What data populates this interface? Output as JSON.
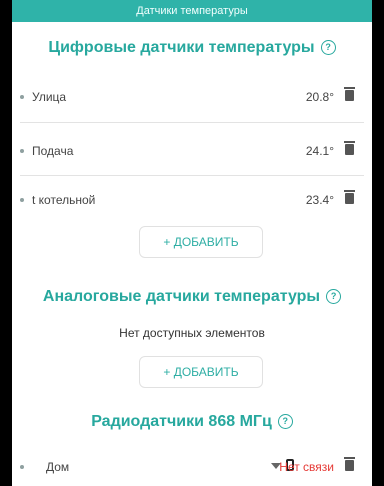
{
  "header": {
    "title": "Датчики температуры"
  },
  "digital": {
    "title": "Цифровые датчики температуры",
    "help": "?",
    "items": [
      {
        "label": "Улица",
        "value": "20.8°"
      },
      {
        "label": "Подача",
        "value": "24.1°"
      },
      {
        "label": "t котельной",
        "value": "23.4°"
      }
    ],
    "add_label": "+  ДОБАВИТЬ"
  },
  "analog": {
    "title": "Аналоговые датчики температуры",
    "help": "?",
    "empty_text": "Нет доступных элементов",
    "add_label": "+  ДОБАВИТЬ"
  },
  "radio": {
    "title": "Радиодатчики 868 МГц",
    "help": "?",
    "items": [
      {
        "label": "Дом",
        "status": "Нет связи",
        "icons": [
          "signal-icon",
          "battery-icon"
        ]
      }
    ]
  },
  "colors": {
    "accent": "#2fb3a9",
    "danger": "#e53935"
  }
}
